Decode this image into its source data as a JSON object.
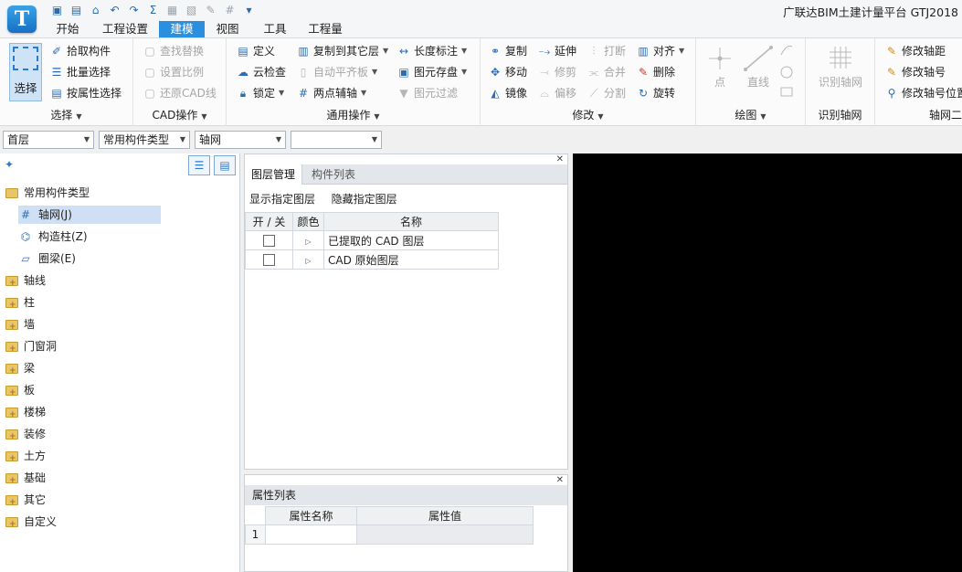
{
  "app": {
    "logo_letter": "T",
    "title": "广联达BIM土建计量平台 GTJ2018"
  },
  "quick_access": [
    "save-icon",
    "new-file-icon",
    "open-folder-icon",
    "undo-icon",
    "redo-icon",
    "sum-icon",
    "calc-icon",
    "report-icon",
    "settings-icon",
    "grid-icon",
    "more-icon"
  ],
  "menu": {
    "tabs": [
      "开始",
      "工程设置",
      "建模",
      "视图",
      "工具",
      "工程量"
    ],
    "active": "建模"
  },
  "ribbon": {
    "select_group": {
      "select": "选择",
      "pick": "拾取构件",
      "batch": "批量选择",
      "by_attr": "按属性选择",
      "label": "选择"
    },
    "cad_group": {
      "find_replace": "查找替换",
      "set_scale": "设置比例",
      "restore_cad": "还原CAD线",
      "label": "CAD操作"
    },
    "common_group": {
      "define": "定义",
      "cloud_check": "云检查",
      "lock": "锁定",
      "copy_to_floor": "复制到其它层",
      "auto_align": "自动平齐板",
      "two_point_axis": "两点辅轴",
      "length_dim": "长度标注",
      "save_element": "图元存盘",
      "element_filter": "图元过滤",
      "label": "通用操作"
    },
    "modify_group": {
      "copy": "复制",
      "move": "移动",
      "mirror": "镜像",
      "extend": "延伸",
      "trim": "修剪",
      "offset": "偏移",
      "break": "打断",
      "merge": "合并",
      "split": "分割",
      "align": "对齐",
      "delete": "删除",
      "rotate": "旋转",
      "label": "修改"
    },
    "draw_group": {
      "point": "点",
      "line": "直线",
      "label": "绘图"
    },
    "identify_group": {
      "identify_axis": "识别轴网",
      "label": "识别轴网"
    },
    "axis_group": {
      "modify_distance": "修改轴距",
      "modify_number": "修改轴号",
      "modify_number_pos": "修改轴号位置",
      "label": "轴网二"
    }
  },
  "selectors": {
    "floor": "首层",
    "component_type": "常用构件类型",
    "component": "轴网",
    "extra": ""
  },
  "tree": {
    "root": "常用构件类型",
    "children": [
      "轴网(J)",
      "构造柱(Z)",
      "圈梁(E)"
    ],
    "categories": [
      "轴线",
      "柱",
      "墙",
      "门窗洞",
      "梁",
      "板",
      "楼梯",
      "装修",
      "土方",
      "基础",
      "其它",
      "自定义"
    ]
  },
  "layer_panel": {
    "tabs": [
      "图层管理",
      "构件列表"
    ],
    "show_layers": "显示指定图层",
    "hide_layers": "隐藏指定图层",
    "columns": [
      "开 / 关",
      "颜色",
      "名称"
    ],
    "rows": [
      {
        "name": "已提取的 CAD 图层",
        "checked": false
      },
      {
        "name": "CAD 原始图层",
        "checked": false
      }
    ]
  },
  "prop_panel": {
    "title": "属性列表",
    "columns": [
      "属性名称",
      "属性值"
    ],
    "rows": [
      {
        "index": "1",
        "name": "",
        "value": ""
      }
    ]
  }
}
